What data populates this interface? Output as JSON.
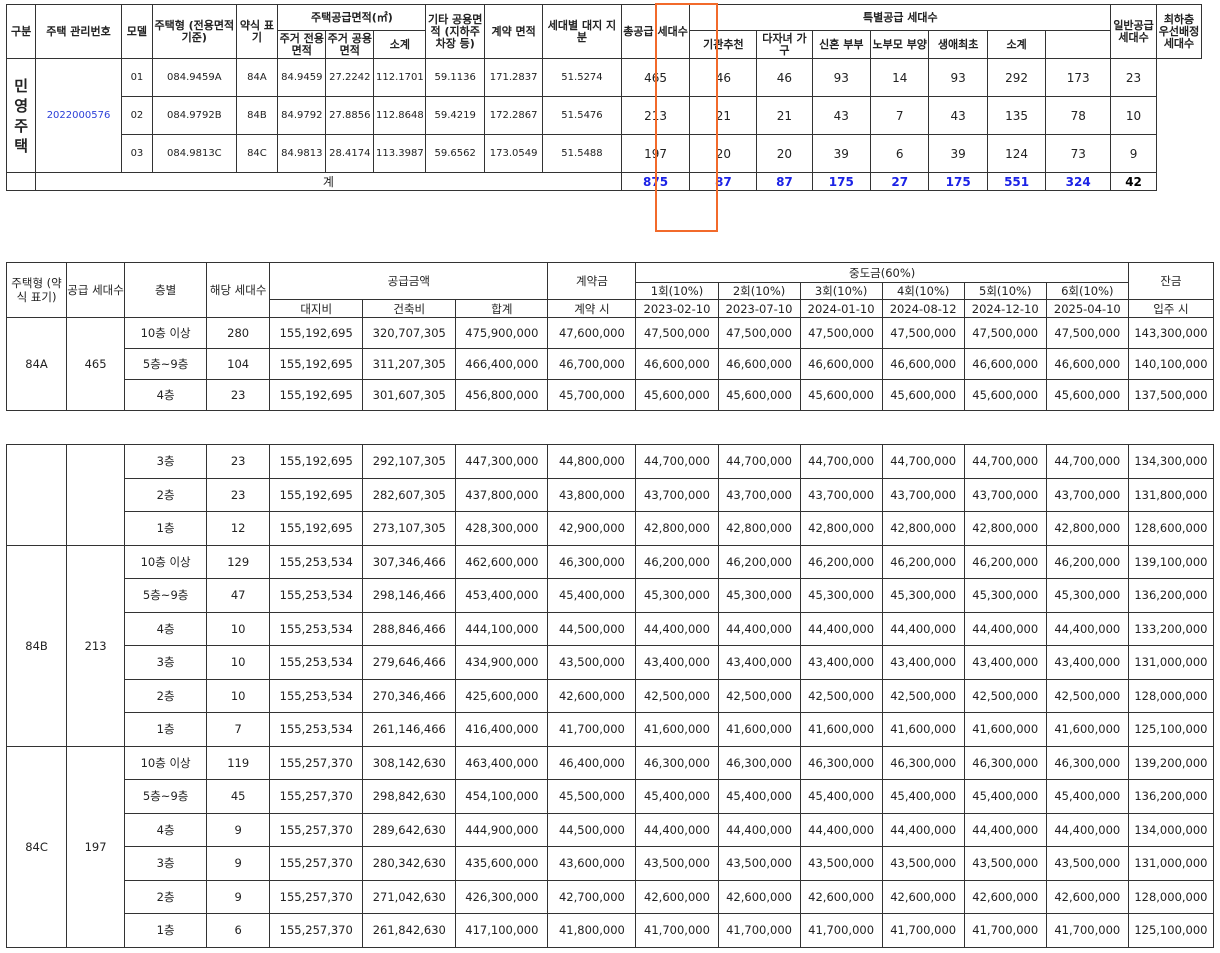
{
  "summary": {
    "headers": {
      "region": "구분",
      "mgmt_no": "주택 관리번호",
      "model": "모델",
      "house_type": "주택형 (전용면적 기준)",
      "abbr": "약식 표기",
      "supply_area": "주택공급면적(㎡)",
      "exclusive": "주거 전용면적",
      "common": "주거 공용면적",
      "subtotal": "소계",
      "other_common": "기타 공용면적 (지하주차장 등)",
      "contract_area": "계약 면적",
      "land_share": "세대별 대지 지분",
      "total_supply": "총공급 세대수",
      "special": "특별공급 세대수",
      "agency": "기관추천",
      "multi_child": "다자녀 가구",
      "newlywed": "신혼 부부",
      "elderly": "노부모 부양",
      "first_life": "생애최초",
      "special_subtotal": "소계",
      "general": "일반공급 세대수",
      "lowest_floor": "최하층 우선배정 세대수"
    },
    "region_label": "민영주택",
    "region_chars": [
      "민",
      "영",
      "주",
      "택"
    ],
    "mgmt_number": "2022000576",
    "rows": [
      {
        "model": "01",
        "type": "084.9459A",
        "abbr": "84A",
        "exclusive": "84.9459",
        "common": "27.2242",
        "subtotal": "112.1701",
        "other": "59.1136",
        "contract": "171.2837",
        "land": "51.5274",
        "total": "465",
        "agency": "46",
        "multi": "46",
        "newly": "93",
        "elderly": "14",
        "first": "93",
        "sp_sub": "292",
        "general": "173",
        "lowest": "23"
      },
      {
        "model": "02",
        "type": "084.9792B",
        "abbr": "84B",
        "exclusive": "84.9792",
        "common": "27.8856",
        "subtotal": "112.8648",
        "other": "59.4219",
        "contract": "172.2867",
        "land": "51.5476",
        "total": "213",
        "agency": "21",
        "multi": "21",
        "newly": "43",
        "elderly": "7",
        "first": "43",
        "sp_sub": "135",
        "general": "78",
        "lowest": "10"
      },
      {
        "model": "03",
        "type": "084.9813C",
        "abbr": "84C",
        "exclusive": "84.9813",
        "common": "28.4174",
        "subtotal": "113.3987",
        "other": "59.6562",
        "contract": "173.0549",
        "land": "51.5488",
        "total": "197",
        "agency": "20",
        "multi": "20",
        "newly": "39",
        "elderly": "6",
        "first": "39",
        "sp_sub": "124",
        "general": "73",
        "lowest": "9"
      }
    ],
    "totals": {
      "label": "계",
      "total": "875",
      "agency": "87",
      "multi": "87",
      "newly": "175",
      "elderly": "27",
      "first": "175",
      "sp_sub": "551",
      "general": "324",
      "lowest": "42"
    }
  },
  "price": {
    "headers": {
      "type": "주택형 (약식 표기)",
      "supply_count": "공급 세대수",
      "floor": "층별",
      "units": "해당 세대수",
      "supply_price": "공급금액",
      "land": "대지비",
      "building": "건축비",
      "sum": "합계",
      "deposit": "계약금",
      "deposit_when": "계약 시",
      "middle": "중도금(60%)",
      "balance": "잔금",
      "balance_when": "입주 시",
      "installments": [
        {
          "label": "1회(10%)",
          "date": "2023-02-10"
        },
        {
          "label": "2회(10%)",
          "date": "2023-07-10"
        },
        {
          "label": "3회(10%)",
          "date": "2024-01-10"
        },
        {
          "label": "4회(10%)",
          "date": "2024-08-12"
        },
        {
          "label": "5회(10%)",
          "date": "2024-12-10"
        },
        {
          "label": "6회(10%)",
          "date": "2025-04-10"
        }
      ]
    },
    "groups": [
      {
        "type": "84A",
        "count": "465",
        "rows": [
          {
            "floor": "10층 이상",
            "units": "280",
            "land": "155,192,695",
            "build": "320,707,305",
            "sum": "475,900,000",
            "deposit": "47,600,000",
            "mid": "47,500,000",
            "balance": "143,300,000"
          },
          {
            "floor": "5층~9층",
            "units": "104",
            "land": "155,192,695",
            "build": "311,207,305",
            "sum": "466,400,000",
            "deposit": "46,700,000",
            "mid": "46,600,000",
            "balance": "140,100,000"
          },
          {
            "floor": "4층",
            "units": "23",
            "land": "155,192,695",
            "build": "301,607,305",
            "sum": "456,800,000",
            "deposit": "45,700,000",
            "mid": "45,600,000",
            "balance": "137,500,000"
          },
          {
            "floor": "3층",
            "units": "23",
            "land": "155,192,695",
            "build": "292,107,305",
            "sum": "447,300,000",
            "deposit": "44,800,000",
            "mid": "44,700,000",
            "balance": "134,300,000"
          },
          {
            "floor": "2층",
            "units": "23",
            "land": "155,192,695",
            "build": "282,607,305",
            "sum": "437,800,000",
            "deposit": "43,800,000",
            "mid": "43,700,000",
            "balance": "131,800,000"
          },
          {
            "floor": "1층",
            "units": "12",
            "land": "155,192,695",
            "build": "273,107,305",
            "sum": "428,300,000",
            "deposit": "42,900,000",
            "mid": "42,800,000",
            "balance": "128,600,000"
          }
        ]
      },
      {
        "type": "84B",
        "count": "213",
        "rows": [
          {
            "floor": "10층 이상",
            "units": "129",
            "land": "155,253,534",
            "build": "307,346,466",
            "sum": "462,600,000",
            "deposit": "46,300,000",
            "mid": "46,200,000",
            "balance": "139,100,000"
          },
          {
            "floor": "5층~9층",
            "units": "47",
            "land": "155,253,534",
            "build": "298,146,466",
            "sum": "453,400,000",
            "deposit": "45,400,000",
            "mid": "45,300,000",
            "balance": "136,200,000"
          },
          {
            "floor": "4층",
            "units": "10",
            "land": "155,253,534",
            "build": "288,846,466",
            "sum": "444,100,000",
            "deposit": "44,500,000",
            "mid": "44,400,000",
            "balance": "133,200,000"
          },
          {
            "floor": "3층",
            "units": "10",
            "land": "155,253,534",
            "build": "279,646,466",
            "sum": "434,900,000",
            "deposit": "43,500,000",
            "mid": "43,400,000",
            "balance": "131,000,000"
          },
          {
            "floor": "2층",
            "units": "10",
            "land": "155,253,534",
            "build": "270,346,466",
            "sum": "425,600,000",
            "deposit": "42,600,000",
            "mid": "42,500,000",
            "balance": "128,000,000"
          },
          {
            "floor": "1층",
            "units": "7",
            "land": "155,253,534",
            "build": "261,146,466",
            "sum": "416,400,000",
            "deposit": "41,700,000",
            "mid": "41,600,000",
            "balance": "125,100,000"
          }
        ]
      },
      {
        "type": "84C",
        "count": "197",
        "rows": [
          {
            "floor": "10층 이상",
            "units": "119",
            "land": "155,257,370",
            "build": "308,142,630",
            "sum": "463,400,000",
            "deposit": "46,400,000",
            "mid": "46,300,000",
            "balance": "139,200,000"
          },
          {
            "floor": "5층~9층",
            "units": "45",
            "land": "155,257,370",
            "build": "298,842,630",
            "sum": "454,100,000",
            "deposit": "45,500,000",
            "mid": "45,400,000",
            "balance": "136,200,000"
          },
          {
            "floor": "4층",
            "units": "9",
            "land": "155,257,370",
            "build": "289,642,630",
            "sum": "444,900,000",
            "deposit": "44,500,000",
            "mid": "44,400,000",
            "balance": "134,000,000"
          },
          {
            "floor": "3층",
            "units": "9",
            "land": "155,257,370",
            "build": "280,342,630",
            "sum": "435,600,000",
            "deposit": "43,600,000",
            "mid": "43,500,000",
            "balance": "131,000,000"
          },
          {
            "floor": "2층",
            "units": "9",
            "land": "155,257,370",
            "build": "271,042,630",
            "sum": "426,300,000",
            "deposit": "42,700,000",
            "mid": "42,600,000",
            "balance": "128,000,000"
          },
          {
            "floor": "1층",
            "units": "6",
            "land": "155,257,370",
            "build": "261,842,630",
            "sum": "417,100,000",
            "deposit": "41,800,000",
            "mid": "41,700,000",
            "balance": "125,100,000"
          }
        ]
      }
    ]
  },
  "colors": {
    "highlight_border": "#f26a2b",
    "total_text": "#1c23e6",
    "link_text": "#2b3fd8"
  }
}
